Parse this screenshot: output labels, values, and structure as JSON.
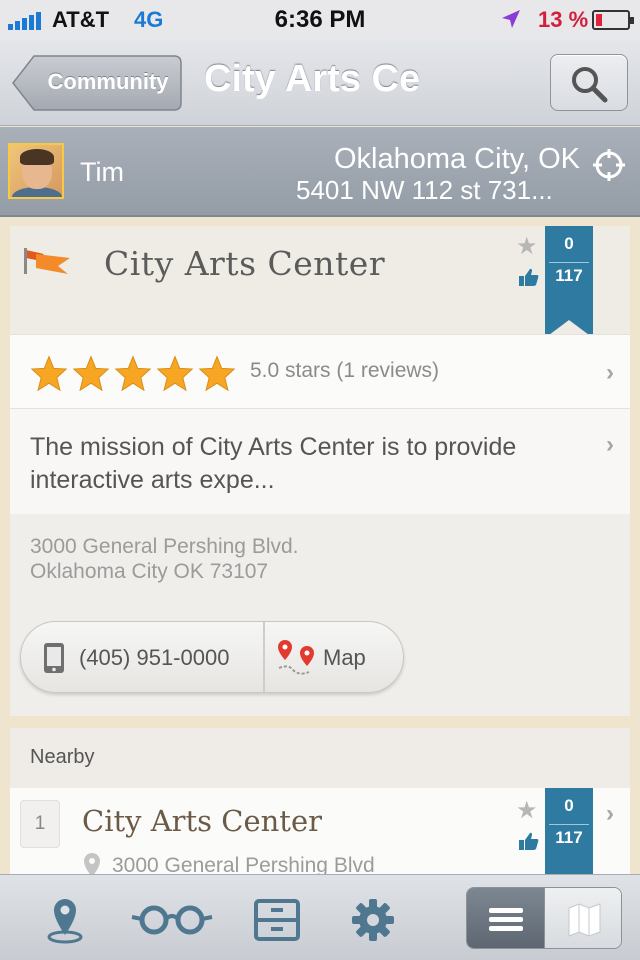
{
  "status_bar": {
    "carrier": "AT&T",
    "network": "4G",
    "time": "6:36 PM",
    "battery_percent": "13 %",
    "battery_level": 0.13
  },
  "nav": {
    "back_label": "Community",
    "title": "City Arts Ce",
    "search_icon": "search-icon"
  },
  "user": {
    "name": "Tim",
    "location_city": "Oklahoma City, OK",
    "location_address": "5401 NW 112 st 731..."
  },
  "place": {
    "title": "City Arts Center",
    "favorites": "0",
    "likes": "117",
    "rating_stars": 5,
    "rating_text": "5.0 stars  (1 reviews)",
    "description": "The mission of City Arts Center is to provide interactive arts expe...",
    "address_line1": "3000 General Pershing Blvd.",
    "address_line2": "Oklahoma City OK 73107",
    "phone": "(405) 951-0000",
    "map_label": "Map"
  },
  "nearby": {
    "label": "Nearby",
    "items": [
      {
        "number": "1",
        "title": "City Arts Center",
        "address": "3000 General Pershing Blvd",
        "favorites": "0",
        "likes": "117"
      }
    ]
  },
  "tabbar": {
    "tabs": [
      "location-pin-icon",
      "glasses-icon",
      "cabinet-icon",
      "gear-icon"
    ],
    "view_toggle": [
      "list-icon",
      "map-icon"
    ],
    "active_view": "list"
  },
  "colors": {
    "ribbon": "#2e7aa0",
    "star": "#f6a623",
    "accent_blue": "#1a7ad6",
    "battery_red": "#d21f3c"
  }
}
